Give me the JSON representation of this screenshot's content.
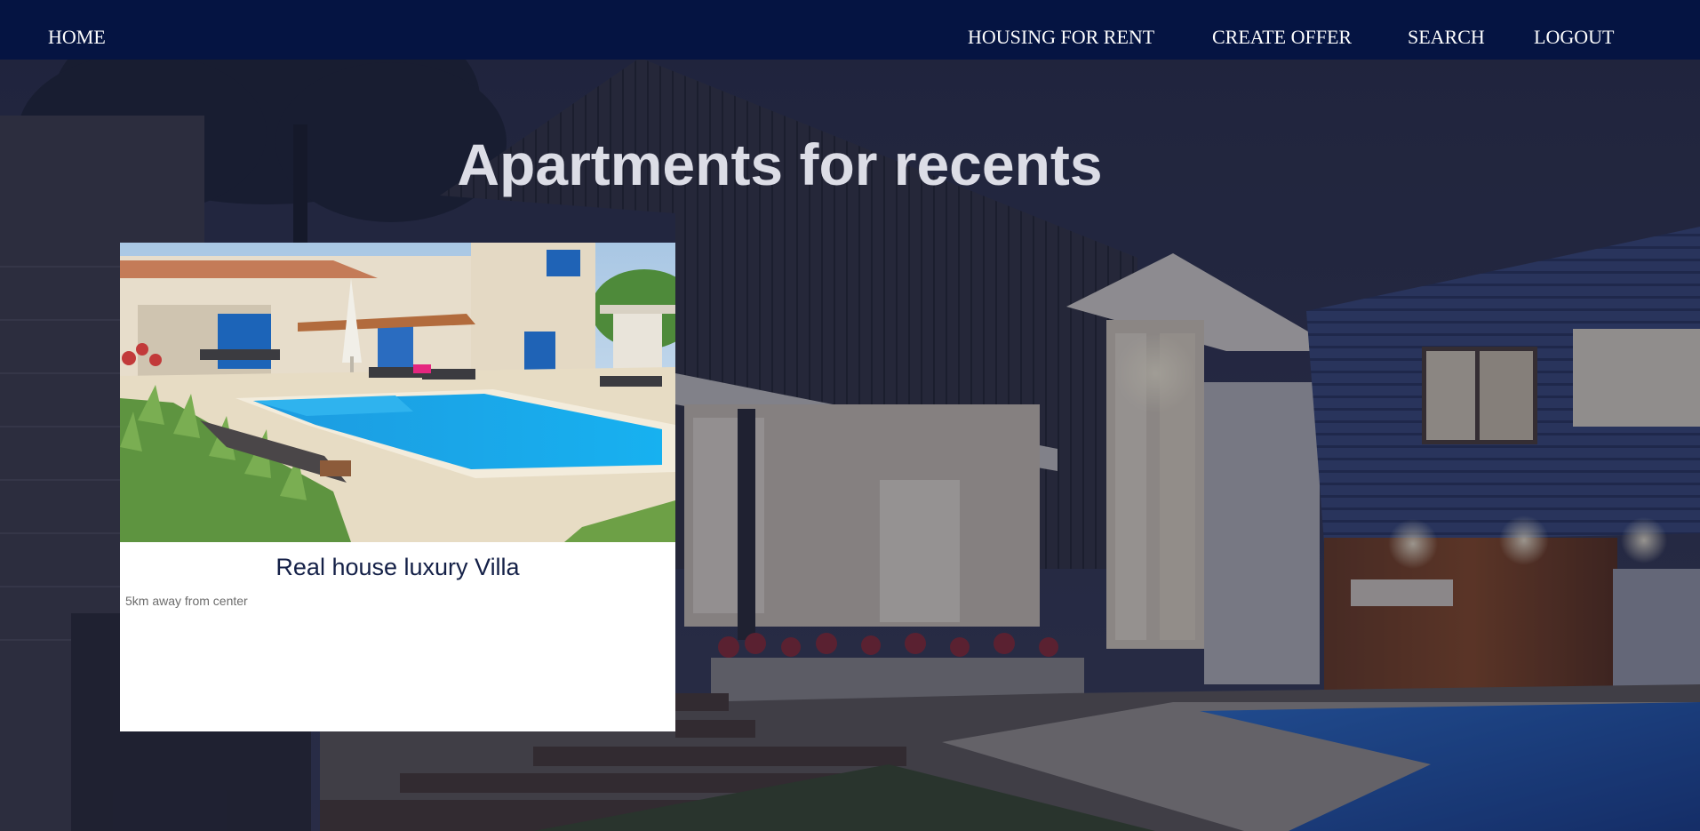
{
  "nav": {
    "home": "HOME",
    "links": [
      "HOUSING FOR RENT",
      "CREATE OFFER",
      "SEARCH",
      "LOGOUT"
    ]
  },
  "hero": {
    "title": "Apartments for recents"
  },
  "listings": [
    {
      "title": "Real house luxury Villa",
      "description": "5km away from center"
    }
  ],
  "colors": {
    "navbar": "#051442",
    "nav_text": "#ffffff",
    "title_text": "#dcdde6",
    "card_title": "#142047",
    "card_desc": "#6c6c6c"
  }
}
